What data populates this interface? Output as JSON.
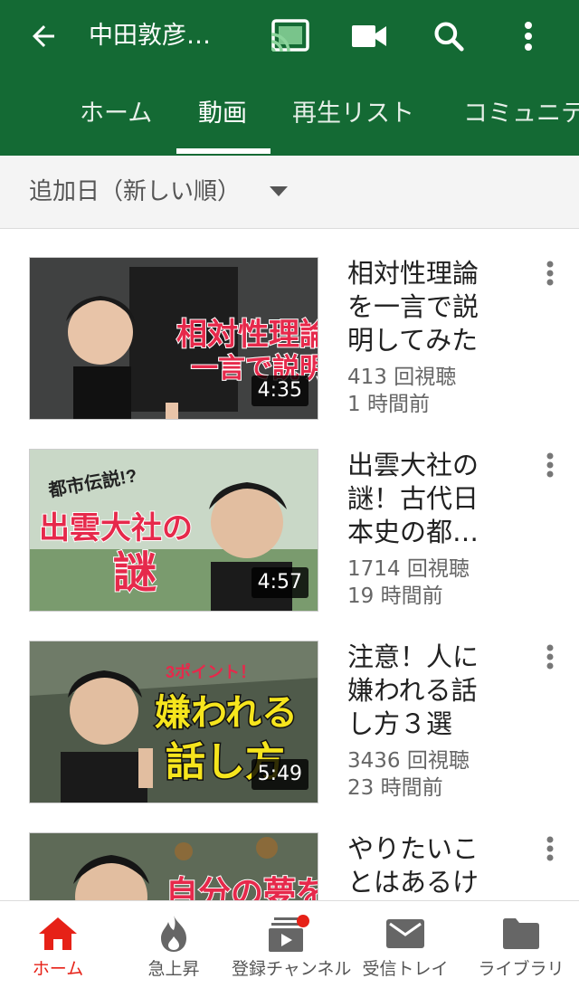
{
  "header": {
    "channel_title": "中田敦彦…",
    "tabs": [
      {
        "label": "ホーム"
      },
      {
        "label": "動画"
      },
      {
        "label": "再生リスト"
      },
      {
        "label": "コミュニテ"
      }
    ],
    "active_tab": "動画",
    "icons": [
      "back-arrow-icon",
      "cast-icon",
      "video-camera-icon",
      "search-icon",
      "more-vert-icon"
    ],
    "color": "#146a34"
  },
  "sort": {
    "label": "追加日（新しい順）"
  },
  "videos": [
    {
      "title": "相対性理論を一言で説明してみた",
      "duration": "4:35",
      "views": "413 回視聴",
      "age": "1 時間前",
      "thumb_text": [
        "相対性理論",
        "一言で説明"
      ]
    },
    {
      "title": "出雲大社の謎！古代日本史の都…",
      "duration": "4:57",
      "views": "1714 回視聴",
      "age": "19 時間前",
      "thumb_text": [
        "都市伝説!?",
        "出雲大社の",
        "謎"
      ]
    },
    {
      "title": "注意！人に嫌われる話し方３選",
      "duration": "5:49",
      "views": "3436 回視聴",
      "age": "23 時間前",
      "thumb_text": [
        "3ポイント！",
        "嫌われる",
        "話し方"
      ]
    },
    {
      "title": "やりたいことはあるけ",
      "thumb_text": [
        "自分の夢を"
      ]
    }
  ],
  "bottom_nav": [
    {
      "label": "ホーム",
      "icon": "home-icon",
      "active": true
    },
    {
      "label": "急上昇",
      "icon": "flame-icon"
    },
    {
      "label": "登録チャンネル",
      "icon": "subscriptions-icon",
      "badge": true
    },
    {
      "label": "受信トレイ",
      "icon": "inbox-mail-icon"
    },
    {
      "label": "ライブラリ",
      "icon": "folder-icon"
    }
  ],
  "accent": "#e62117"
}
